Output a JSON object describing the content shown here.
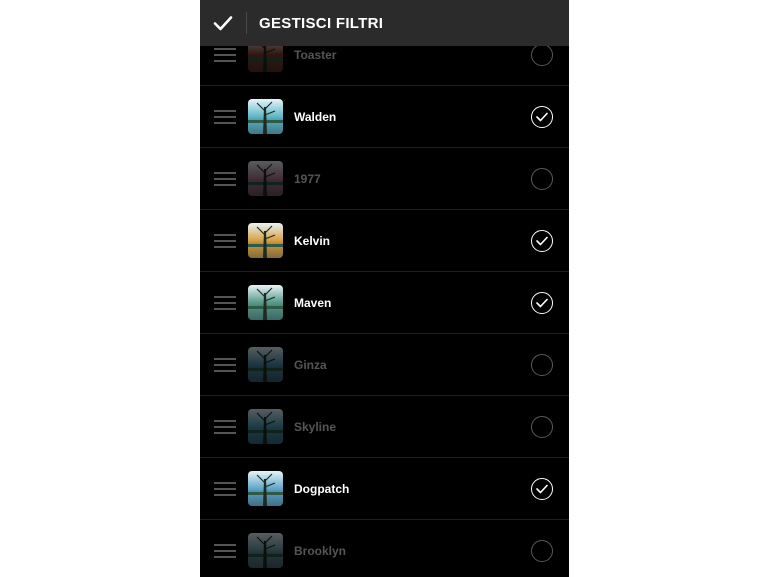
{
  "header": {
    "title": "GESTISCI FILTRI",
    "confirm_icon": "check-icon"
  },
  "filters": [
    {
      "name": "Toaster",
      "enabled": false,
      "tint": "#8a3a2a"
    },
    {
      "name": "Walden",
      "enabled": true,
      "tint": "#5fb8c8"
    },
    {
      "name": "1977",
      "enabled": false,
      "tint": "#b07890"
    },
    {
      "name": "Kelvin",
      "enabled": true,
      "tint": "#d8a040"
    },
    {
      "name": "Maven",
      "enabled": true,
      "tint": "#5a9a8a"
    },
    {
      "name": "Ginza",
      "enabled": false,
      "tint": "#4a90b0"
    },
    {
      "name": "Skyline",
      "enabled": false,
      "tint": "#4aa0c0"
    },
    {
      "name": "Dogpatch",
      "enabled": true,
      "tint": "#60a8c8"
    },
    {
      "name": "Brooklyn",
      "enabled": false,
      "tint": "#6a98a8"
    }
  ]
}
